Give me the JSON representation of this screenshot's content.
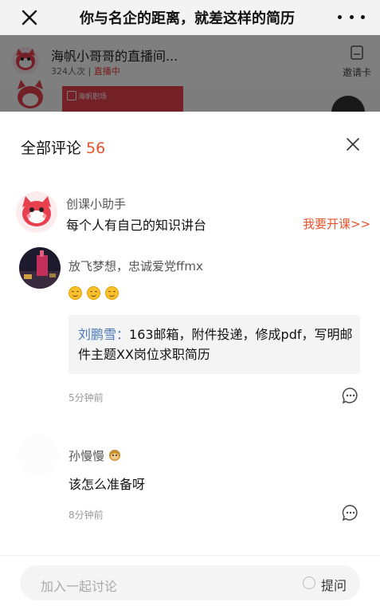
{
  "navbar": {
    "title": "你与名企的距离，就差这样的简历",
    "close_icon": "close-icon",
    "more_icon": "more-dots-icon"
  },
  "live": {
    "name": "海帆小哥哥的直播间...",
    "viewers": "324人次",
    "separator": " | ",
    "status": "直播中",
    "invite_label": "邀请卡"
  },
  "background": {
    "card_text": "海帆职场"
  },
  "comments_panel": {
    "title": "全部评论",
    "count": "56",
    "accent_color": "#e4552d"
  },
  "comments": [
    {
      "name": "创课小助手",
      "text": "每个人有自己的知识讲台",
      "link": "我要开课>>"
    },
    {
      "name": "放飞梦想，忠诚爱党ffmx",
      "emoji_count": 3,
      "reply": {
        "author": "刘鹏雪：",
        "text": "163邮箱，附件投递，修成pdf，写明邮件主题XX岗位求职简历"
      },
      "time": "5分钟前"
    },
    {
      "name": "孙慢慢",
      "text": "该怎么准备呀",
      "time": "8分钟前"
    }
  ],
  "composer": {
    "placeholder": "加入一起讨论",
    "ask_label": "提问"
  }
}
